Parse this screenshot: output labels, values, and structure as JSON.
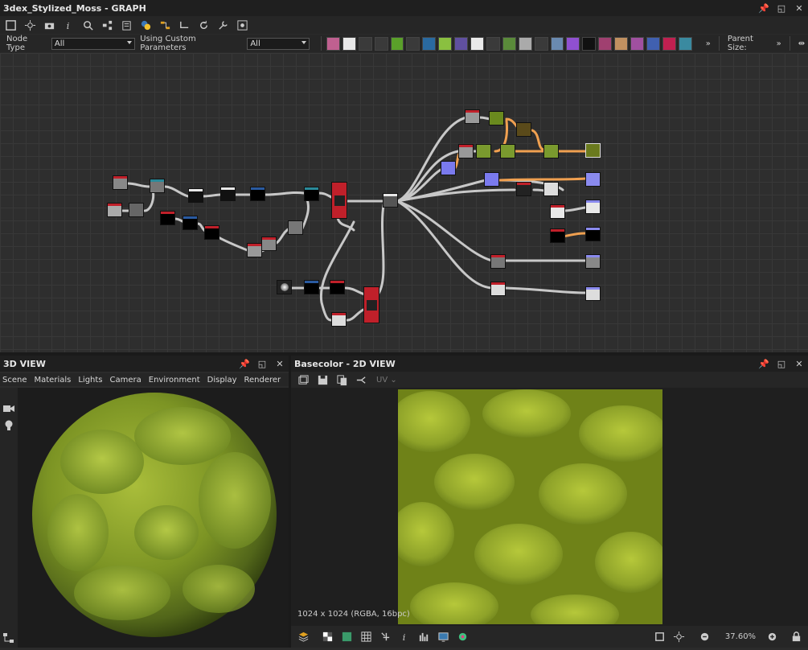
{
  "graph_panel": {
    "title": "3dex_Stylized_Moss - GRAPH",
    "node_type_label": "Node Type",
    "node_type_value": "All",
    "custom_params_label": "Using Custom Parameters",
    "custom_params_value": "All",
    "parent_size_label": "Parent Size:",
    "overflow_glyph": "»"
  },
  "view3d": {
    "title": "3D VIEW",
    "menu": [
      "Scene",
      "Materials",
      "Lights",
      "Camera",
      "Environment",
      "Display",
      "Renderer"
    ]
  },
  "view2d": {
    "title": "Basecolor - 2D VIEW",
    "channel": "UV",
    "info": "1024 x 1024 (RGBA, 16bpc)",
    "zoom": "37.60%"
  },
  "colors": {
    "accent_orange": "#f0a050",
    "moss_green": "#7a8f1e",
    "node_red": "#c0202a"
  }
}
